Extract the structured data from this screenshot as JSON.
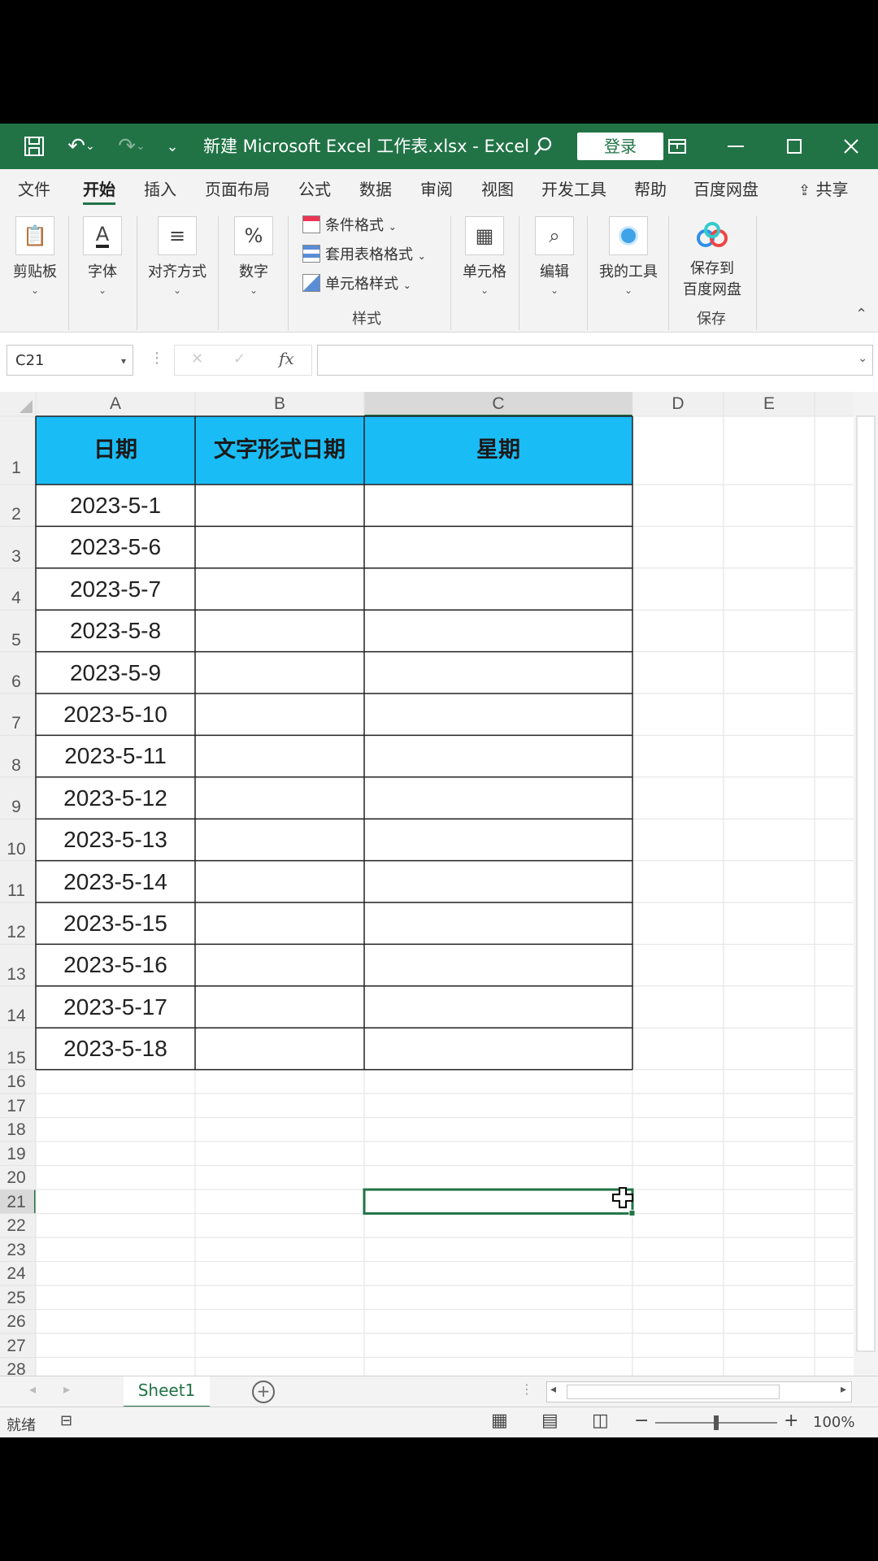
{
  "window": {
    "title": "新建 Microsoft Excel 工作表.xlsx  -  Excel",
    "login_label": "登录",
    "controls": [
      "minimize-icon",
      "maximize-icon",
      "close-icon"
    ]
  },
  "tabs": [
    "文件",
    "开始",
    "插入",
    "页面布局",
    "公式",
    "数据",
    "审阅",
    "视图",
    "开发工具",
    "帮助",
    "百度网盘"
  ],
  "active_tab": "开始",
  "share_label": "共享",
  "ribbon": {
    "clipboard": "剪贴板",
    "font": "字体",
    "align": "对齐方式",
    "number": "数字",
    "styles": {
      "conditional": "条件格式",
      "table_format": "套用表格格式",
      "cell_style": "单元格样式",
      "caption": "样式"
    },
    "cells": "单元格",
    "edit": "编辑",
    "my_tools": "我的工具",
    "save_baidu_1": "保存到",
    "save_baidu_2": "百度网盘",
    "save_caption": "保存"
  },
  "formula_bar": {
    "name_box": "C21",
    "fx": "fx",
    "value": ""
  },
  "columns": [
    "A",
    "B",
    "C",
    "D",
    "E"
  ],
  "rows": [
    "1",
    "2",
    "3",
    "4",
    "5",
    "6",
    "7",
    "8",
    "9",
    "10",
    "11",
    "12",
    "13",
    "14",
    "15",
    "16",
    "17",
    "18",
    "19",
    "20",
    "21",
    "22",
    "23",
    "24",
    "25",
    "26",
    "27",
    "28"
  ],
  "table": {
    "headers": [
      "日期",
      "文字形式日期",
      "星期"
    ],
    "dates": [
      "2023-5-1",
      "2023-5-6",
      "2023-5-7",
      "2023-5-8",
      "2023-5-9",
      "2023-5-10",
      "2023-5-11",
      "2023-5-12",
      "2023-5-13",
      "2023-5-14",
      "2023-5-15",
      "2023-5-16",
      "2023-5-17",
      "2023-5-18"
    ],
    "header_color": "#1ABCF5"
  },
  "selected_cell": "C21",
  "sheet_tab": "Sheet1",
  "status": {
    "ready": "就绪",
    "zoom": "100%",
    "zoom_level": 1.0
  },
  "accent_color": "#217346"
}
